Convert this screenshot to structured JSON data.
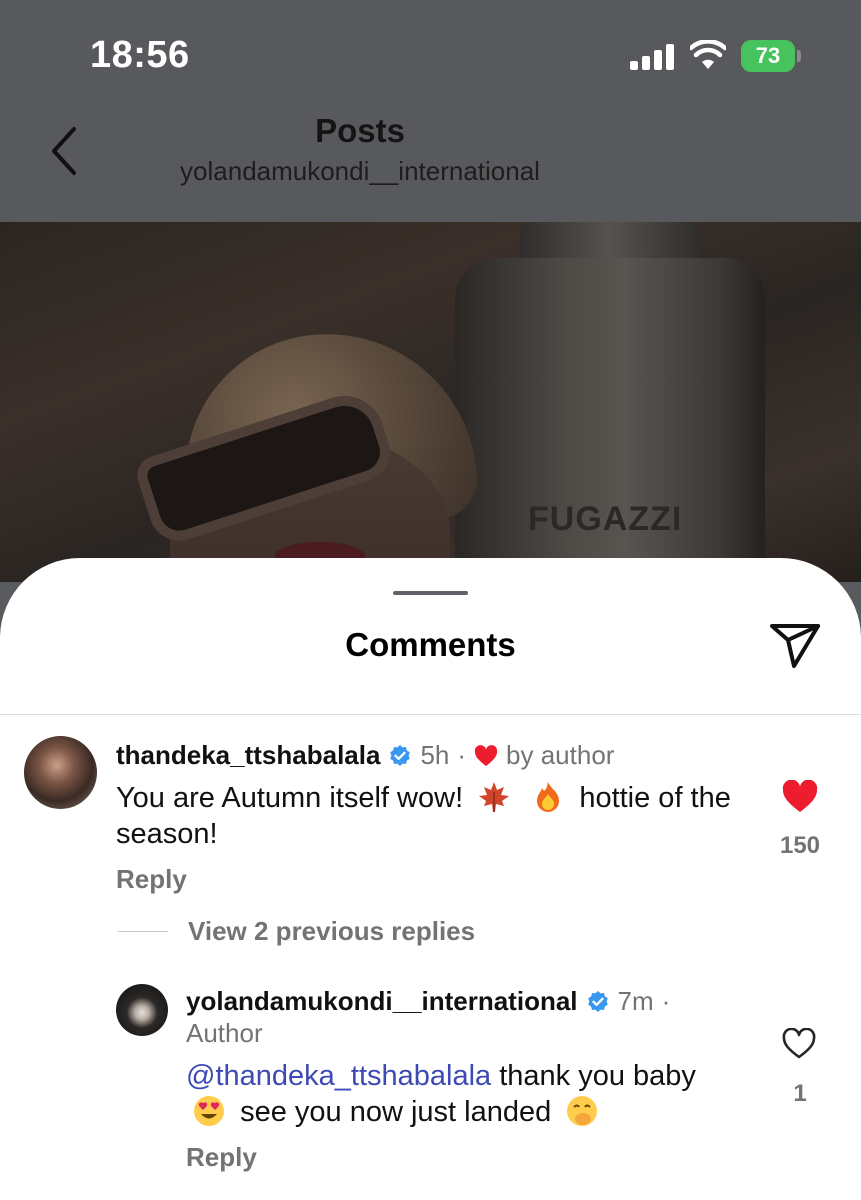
{
  "status_bar": {
    "time": "18:56",
    "battery": "73"
  },
  "header": {
    "title": "Posts",
    "subtitle": "yolandamukondi__international"
  },
  "photo": {
    "brand_text": "FUGAZZI"
  },
  "sheet": {
    "title": "Comments"
  },
  "comments": [
    {
      "username": "thandeka_ttshabalala",
      "time": "5h",
      "separator": "·",
      "liked_label": "by author",
      "text_part1": "You are Autumn itself wow!",
      "text_part2": "hottie of the season!",
      "reply_label": "Reply",
      "like_count": "150"
    }
  ],
  "view_replies": "View 2 previous replies",
  "reply": {
    "username": "yolandamukondi__international",
    "time": "7m",
    "separator": "·",
    "author_label": "Author",
    "mention": "@thandeka_ttshabalala",
    "text_part1": "thank you baby",
    "text_part2": "see you now just landed",
    "reply_label": "Reply",
    "like_count": "1"
  },
  "colors": {
    "heart": "#ed1c2e",
    "verified": "#3897f0",
    "mention": "#3d4ab3",
    "battery": "#46c35d"
  }
}
